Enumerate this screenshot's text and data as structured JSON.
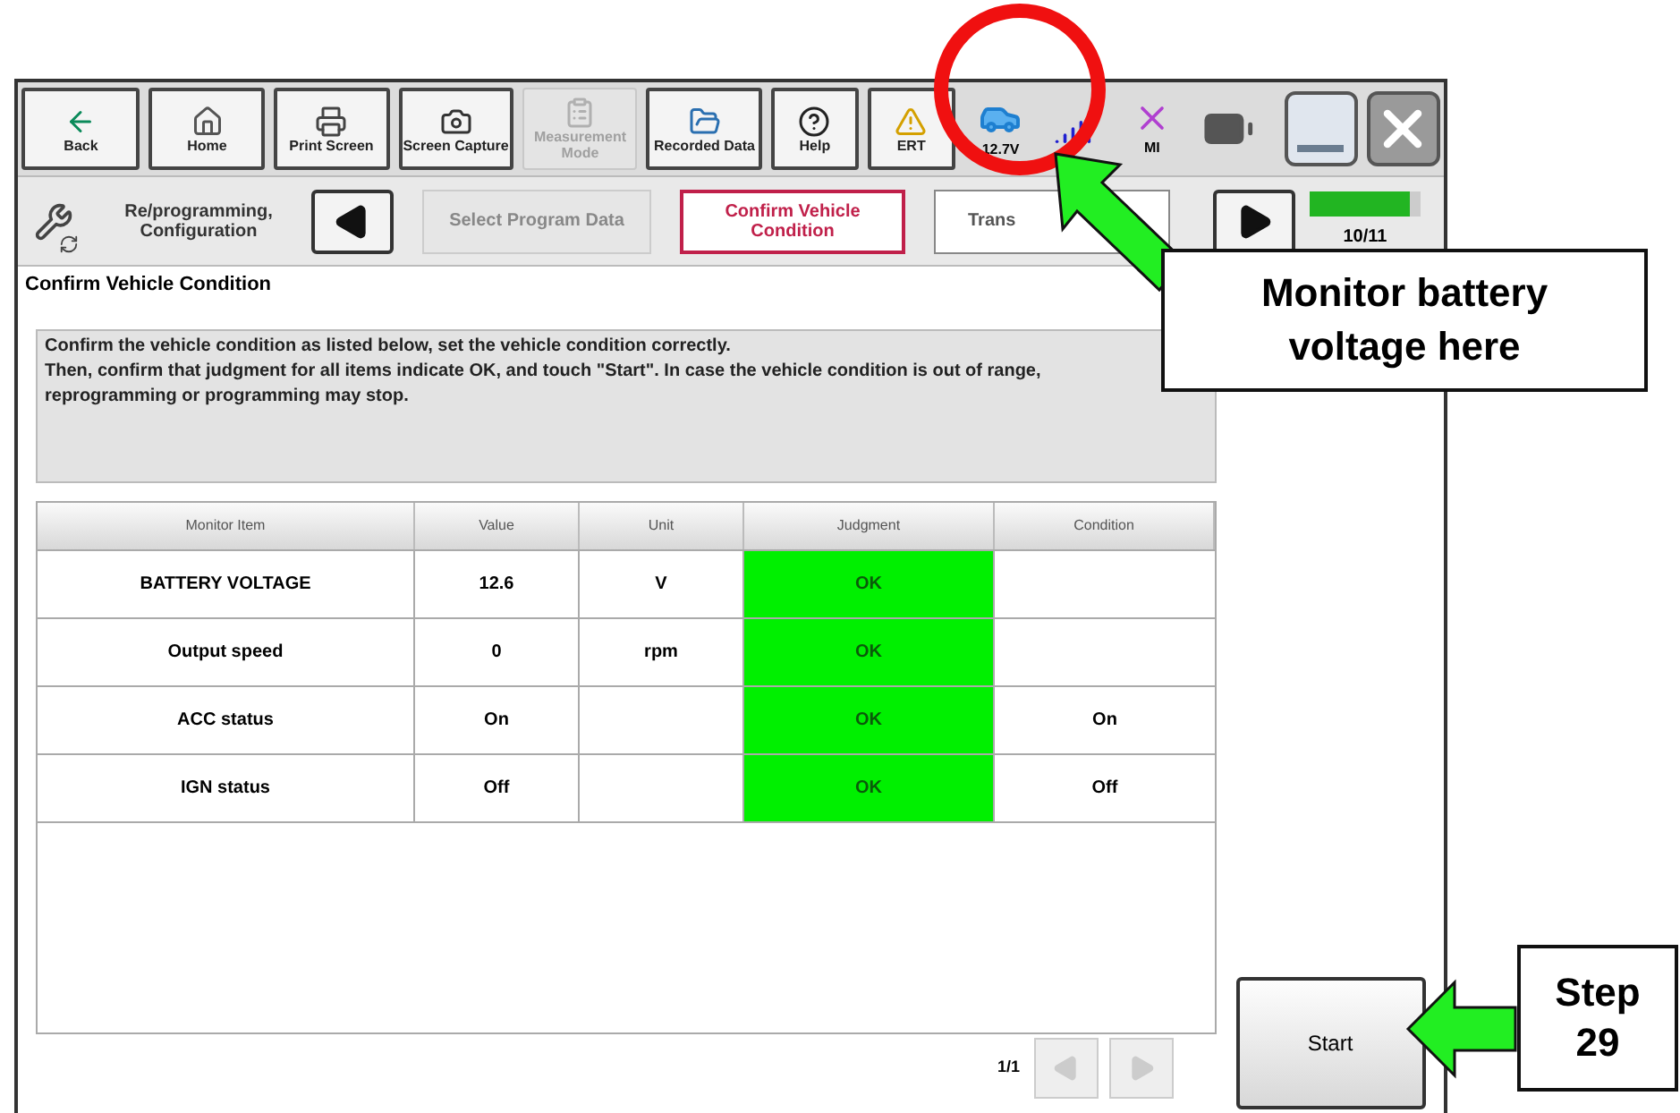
{
  "toolbar": {
    "buttons": [
      {
        "label": "Back",
        "kind": "back",
        "disabled": false
      },
      {
        "label": "Home",
        "kind": "home",
        "disabled": false
      },
      {
        "label": "Print Screen",
        "kind": "print",
        "disabled": false
      },
      {
        "label": "Screen Capture",
        "kind": "camera",
        "disabled": false
      },
      {
        "label": "Measurement Mode",
        "kind": "measure",
        "disabled": true
      },
      {
        "label": "Recorded Data",
        "kind": "folder",
        "disabled": false
      },
      {
        "label": "Help",
        "kind": "help",
        "disabled": false
      },
      {
        "label": "ERT",
        "kind": "warning",
        "disabled": false
      }
    ],
    "status": {
      "battery_voltage": "12.7V",
      "mi": "MI"
    }
  },
  "breadcrumb": {
    "section": "Re/programming, Configuration",
    "steps": [
      {
        "label": "Select Program Data",
        "selected": false
      },
      {
        "label": "Confirm Vehicle Condition",
        "selected": true
      },
      {
        "label": "Trans",
        "selected": false
      }
    ],
    "progress": {
      "level": 0.91,
      "reading": "10/11"
    }
  },
  "page_title": "Confirm Vehicle Condition",
  "message": [
    "Confirm the vehicle condition as listed below, set the vehicle condition correctly.",
    "Then, confirm that judgment for all items indicate OK, and touch \"Start\". In case the vehicle condition is out of range, reprogramming or programming may stop."
  ],
  "table": {
    "columns": [
      "Monitor Item",
      "Value",
      "Unit",
      "Judgment",
      "Condition"
    ],
    "rows": [
      {
        "item": "BATTERY VOLTAGE",
        "value": "12.6",
        "unit": "V",
        "judgment": "OK",
        "ok": true,
        "condition": ""
      },
      {
        "item": "Output speed",
        "value": "0",
        "unit": "rpm",
        "judgment": "OK",
        "ok": true,
        "condition": ""
      },
      {
        "item": "ACC status",
        "value": "On",
        "unit": "",
        "judgment": "OK",
        "ok": true,
        "condition": "On"
      },
      {
        "item": "IGN status",
        "value": "Off",
        "unit": "",
        "judgment": "OK",
        "ok": true,
        "condition": "Off"
      }
    ]
  },
  "pager": {
    "page": "1/1",
    "prev_disabled": true,
    "next_disabled": true
  },
  "start_button": "Start",
  "annotations": [
    {
      "kind": "callout",
      "text": "Monitor battery voltage here"
    },
    {
      "kind": "step",
      "text": "Step 29"
    }
  ]
}
